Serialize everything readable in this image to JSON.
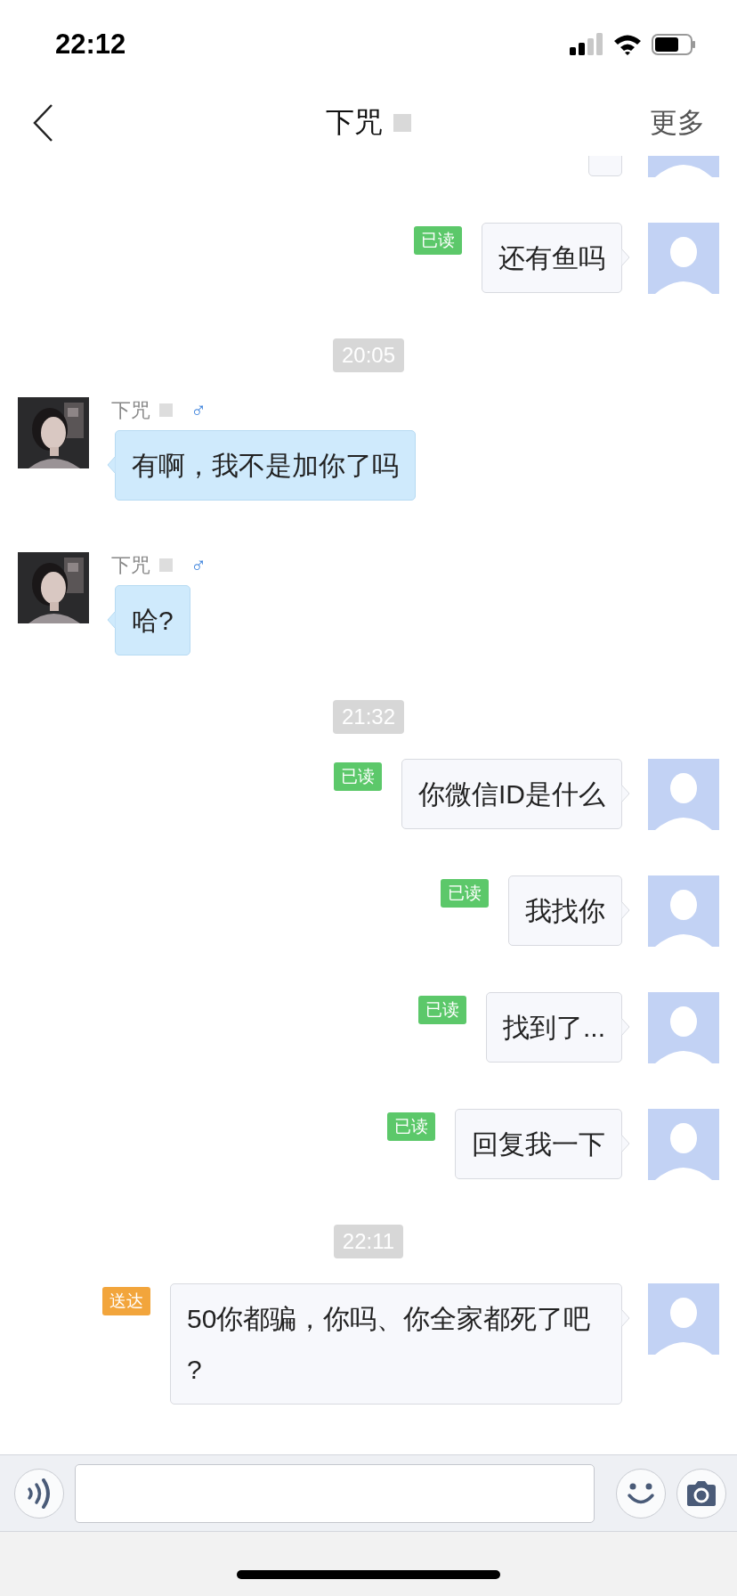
{
  "status_bar": {
    "time": "22:12"
  },
  "nav": {
    "title": "下咒",
    "more": "更多"
  },
  "messages": [
    {
      "kind": "outgoing"
    },
    {
      "kind": "outgoing",
      "text": "还有鱼吗",
      "status": {
        "label": "已读",
        "color": "#5cc86a"
      }
    },
    {
      "kind": "time",
      "text": "20:05"
    },
    {
      "kind": "incoming",
      "name": "下咒",
      "gender": "♂",
      "text": "有啊，我不是加你了吗"
    },
    {
      "kind": "incoming",
      "name": "下咒",
      "gender": "♂",
      "text": "哈?"
    },
    {
      "kind": "time",
      "text": "21:32"
    },
    {
      "kind": "outgoing",
      "text": "你微信ID是什么",
      "status": {
        "label": "已读",
        "color": "#5cc86a"
      }
    },
    {
      "kind": "outgoing",
      "text": "我找你",
      "status": {
        "label": "已读",
        "color": "#5cc86a"
      }
    },
    {
      "kind": "outgoing",
      "text": "找到了...",
      "status": {
        "label": "已读",
        "color": "#5cc86a"
      }
    },
    {
      "kind": "outgoing",
      "text": "回复我一下",
      "status": {
        "label": "已读",
        "color": "#5cc86a"
      }
    },
    {
      "kind": "time",
      "text": "22:11"
    },
    {
      "kind": "outgoing",
      "text": "50你都骗，你吗、你全家都死了吧?",
      "status": {
        "label": "送达",
        "color": "#f2a53c"
      }
    }
  ]
}
